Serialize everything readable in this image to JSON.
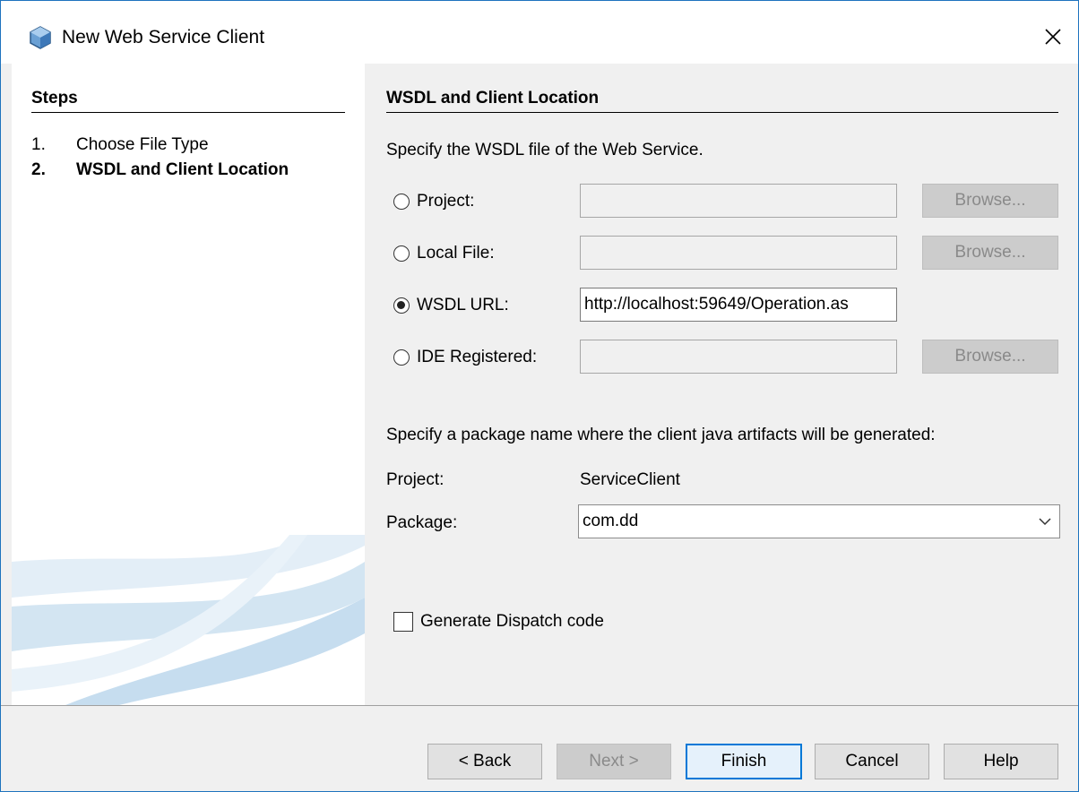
{
  "window": {
    "title": "New Web Service Client",
    "close_glyph": "✕"
  },
  "steps": {
    "header": "Steps",
    "items": [
      {
        "num": "1.",
        "label": "Choose File Type",
        "current": false
      },
      {
        "num": "2.",
        "label": "WSDL and Client Location",
        "current": true
      }
    ]
  },
  "main": {
    "section_title": "WSDL and Client Location",
    "instruction": "Specify the WSDL file of the Web Service.",
    "sources": [
      {
        "label": "Project:",
        "checked": false,
        "value": "",
        "browse": "Browse..."
      },
      {
        "label": "Local File:",
        "checked": false,
        "value": "",
        "browse": "Browse..."
      },
      {
        "label": "WSDL URL:",
        "checked": true,
        "value": "http://localhost:59649/Operation.as"
      },
      {
        "label": "IDE Registered:",
        "checked": false,
        "value": "",
        "browse": "Browse..."
      }
    ],
    "package_instruction": "Specify a package name where the client java artifacts will be generated:",
    "project_label": "Project:",
    "project_value": "ServiceClient",
    "package_label": "Package:",
    "package_value": "com.dd",
    "dispatch_label": "Generate Dispatch code",
    "dispatch_checked": false
  },
  "footer": {
    "back": "< Back",
    "next": "Next >",
    "finish": "Finish",
    "cancel": "Cancel",
    "help": "Help"
  },
  "colors": {
    "accent": "#0078d7",
    "window_border": "#1e73be",
    "panel_bg": "#f0f0f0",
    "disabled_btn": "#cccccc"
  },
  "icons": {
    "title": "netbeans-cube-icon",
    "close": "close-icon",
    "combo": "chevron-down-icon"
  }
}
